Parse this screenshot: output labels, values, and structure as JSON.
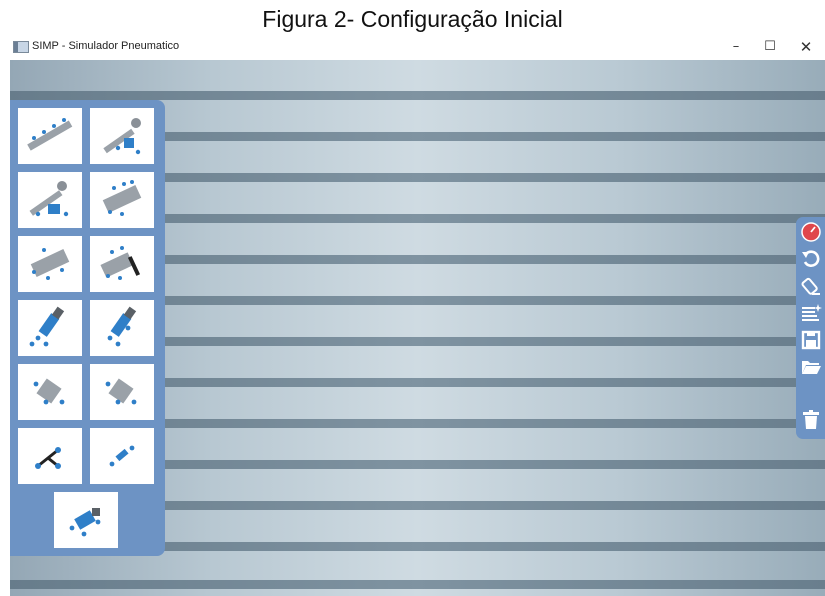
{
  "caption": "Figura 2- Configuração Inicial",
  "window": {
    "title": "SIMP - Simulador Pneumatico",
    "minimize": "–",
    "maximize": "☐",
    "close": "✕"
  },
  "palette": {
    "components": [
      {
        "icon": "manifold-icon"
      },
      {
        "icon": "air-supply-unit-icon"
      },
      {
        "icon": "air-supply-valve-icon"
      },
      {
        "icon": "valve-5-2-icon"
      },
      {
        "icon": "valve-3-2-icon"
      },
      {
        "icon": "hand-lever-valve-icon"
      },
      {
        "icon": "single-acting-cylinder-icon"
      },
      {
        "icon": "double-acting-cylinder-icon"
      },
      {
        "icon": "and-valve-icon"
      },
      {
        "icon": "or-valve-icon"
      },
      {
        "icon": "tee-connector-icon"
      },
      {
        "icon": "flow-control-icon"
      },
      {
        "icon": "pressure-regulator-icon"
      }
    ]
  },
  "toolbar": {
    "tools": [
      {
        "icon": "pressure-gauge-icon"
      },
      {
        "icon": "undo-icon"
      },
      {
        "icon": "eraser-icon"
      },
      {
        "icon": "new-file-icon"
      },
      {
        "icon": "save-icon"
      },
      {
        "icon": "open-folder-icon"
      },
      {
        "icon": "trash-icon"
      }
    ]
  },
  "colors": {
    "panel": "#6d93c4",
    "stripe": "#7b8f9d",
    "component_blue": "#2f7fc8",
    "component_gray": "#9aa1a8",
    "alert_red": "#e0474c"
  }
}
